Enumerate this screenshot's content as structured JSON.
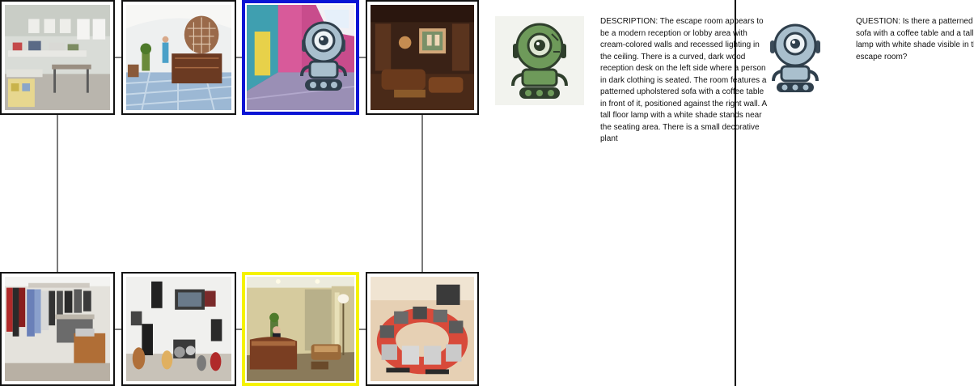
{
  "description": "DESCRIPTION: The escape room appears to be a modern reception or lobby area with cream-colored walls and recessed lighting in the ceiling. There is a curved, dark wood reception desk on the left side where a person in dark clothing is seated. The room features a patterned upholstered sofa with a coffee table in front of it, positioned against the right wall. A tall floor lamp with a white shade stands near the seating area. There is a small decorative plant",
  "question": "QUESTION: Is there a patterned sofa with a coffee table and a tall lamp with white shade visible in this escape room?",
  "rooms": {
    "top": [
      {
        "scene": "craft-workshop",
        "state": "normal"
      },
      {
        "scene": "tiled-lobby-reception",
        "state": "normal"
      },
      {
        "scene": "pink-wall-room",
        "state": "current"
      },
      {
        "scene": "wood-panel-theater",
        "state": "normal"
      }
    ],
    "bottom": [
      {
        "scene": "clothing-closet",
        "state": "normal"
      },
      {
        "scene": "music-studio",
        "state": "normal"
      },
      {
        "scene": "reception-lobby",
        "state": "target"
      },
      {
        "scene": "computer-lab",
        "state": "normal"
      }
    ]
  },
  "colors": {
    "current_border": "#0a14d4",
    "target_border": "#f5f200",
    "robot_green": "#6e9a5a",
    "robot_blue": "#a9bfcd"
  },
  "icons": [
    "green-robot-icon",
    "blue-robot-icon"
  ]
}
